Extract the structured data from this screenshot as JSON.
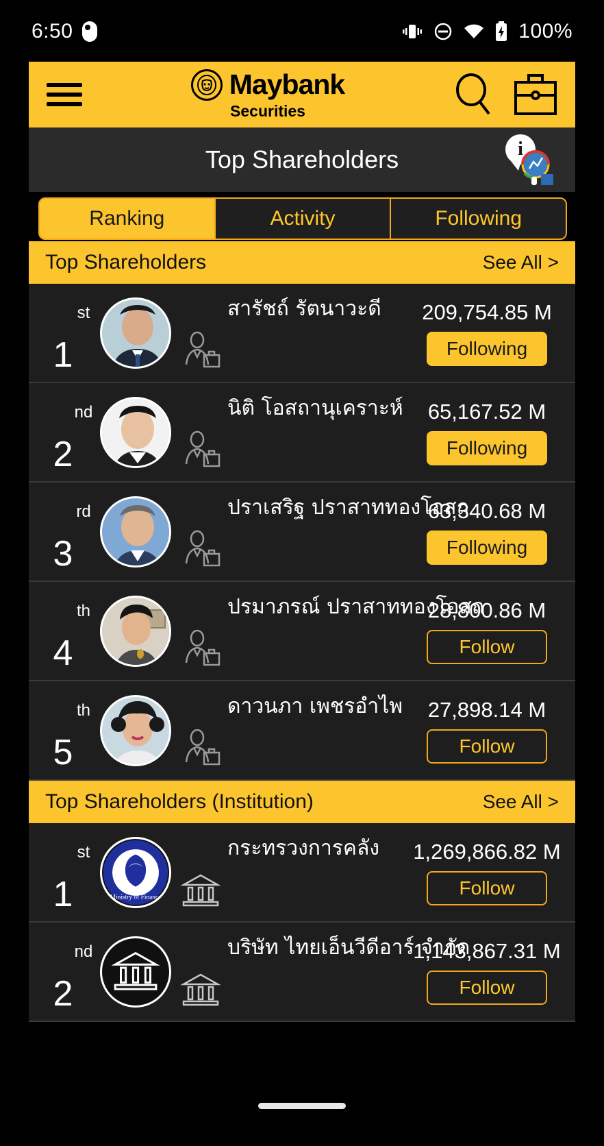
{
  "statusbar": {
    "time": "6:50",
    "battery_label": "100%",
    "icons": [
      "app-dot-icon",
      "vibrate-icon",
      "do-not-disturb-icon",
      "wifi-icon",
      "battery-charging-icon"
    ]
  },
  "header": {
    "menu_icon": "hamburger-menu-icon",
    "brand": "Maybank",
    "brand_sub": "Securities",
    "logo_icon": "maybank-tiger-logo",
    "search_icon": "search-icon",
    "portfolio_icon": "briefcase-icon"
  },
  "titlebar": {
    "title": "Top Shareholders",
    "info_icon": "info-icon",
    "info_glyph": "i",
    "analysis_icon": "market-analysis-icon"
  },
  "tabs": [
    {
      "label": "Ranking",
      "active": true
    },
    {
      "label": "Activity",
      "active": false
    },
    {
      "label": "Following",
      "active": false
    }
  ],
  "colors": {
    "brand_yellow": "#FDC52D",
    "accent_yellow": "#FFC72C",
    "border_yellow": "#F3A81C",
    "row_bg": "#1E1E1E",
    "title_bg": "#2B2B2B",
    "page_bg": "#000000"
  },
  "sections": [
    {
      "title": "Top Shareholders",
      "see_all": "See All >",
      "rows": [
        {
          "rank": "1",
          "suffix": "st",
          "name": "สารัชถ์ รัตนาวะดี",
          "value": "209,754.85 M",
          "action": "Following",
          "following": true,
          "type": "person"
        },
        {
          "rank": "2",
          "suffix": "nd",
          "name": "นิติ โอสถานุเคราะห์",
          "value": "65,167.52 M",
          "action": "Following",
          "following": true,
          "type": "person"
        },
        {
          "rank": "3",
          "suffix": "rd",
          "name": "ปราเสริฐ ปราสาททองโอสถ",
          "value": "63,340.68 M",
          "action": "Following",
          "following": true,
          "type": "person"
        },
        {
          "rank": "4",
          "suffix": "th",
          "name": "ปรมาภรณ์ ปราสาททองโอสถ",
          "value": "28,800.86 M",
          "action": "Follow",
          "following": false,
          "type": "person"
        },
        {
          "rank": "5",
          "suffix": "th",
          "name": "ดาวนภา เพชรอำไพ",
          "value": "27,898.14 M",
          "action": "Follow",
          "following": false,
          "type": "person"
        }
      ]
    },
    {
      "title": "Top Shareholders (Institution)",
      "see_all": "See All >",
      "rows": [
        {
          "rank": "1",
          "suffix": "st",
          "name": "กระทรวงการคลัง",
          "value": "1,269,866.82 M",
          "action": "Follow",
          "following": false,
          "type": "institution",
          "logo": "ministry-of-finance-seal"
        },
        {
          "rank": "2",
          "suffix": "nd",
          "name": "บริษัท ไทยเอ็นวีดีอาร์ จำกัด",
          "value": "1,143,867.31 M",
          "action": "Follow",
          "following": false,
          "type": "institution",
          "logo": "bank-building-icon"
        }
      ]
    }
  ]
}
